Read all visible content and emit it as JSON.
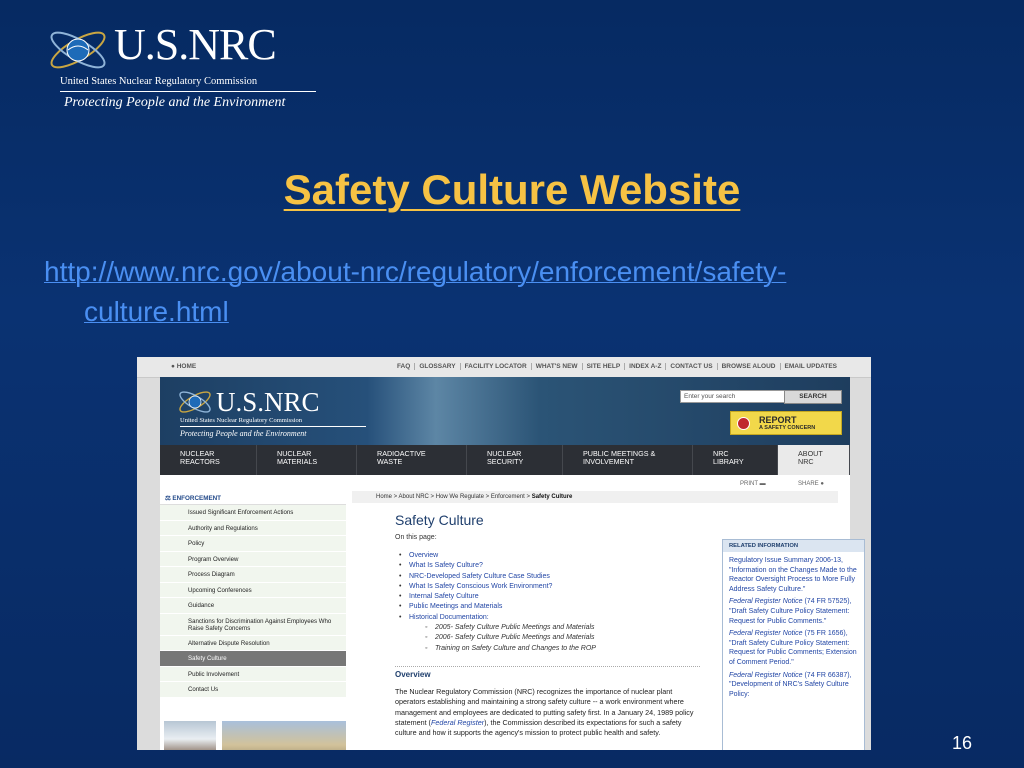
{
  "slide": {
    "logo": {
      "wordmark": "U.S.NRC",
      "agency": "United States Nuclear Regulatory Commission",
      "tagline": "Protecting People and the Environment"
    },
    "title": "Safety Culture Website",
    "url_line1": "http://www.nrc.gov/about-nrc/regulatory/enforcement/safety-",
    "url_line2": "culture.html",
    "page_number": "16"
  },
  "site": {
    "topbar": {
      "home": "HOME",
      "links": [
        "FAQ",
        "GLOSSARY",
        "FACILITY LOCATOR",
        "WHAT'S NEW",
        "SITE HELP",
        "INDEX A-Z",
        "CONTACT US",
        "BROWSE ALOUD",
        "EMAIL UPDATES"
      ]
    },
    "banner": {
      "wordmark": "U.S.NRC",
      "agency": "United States Nuclear Regulatory Commission",
      "tagline": "Protecting People and the Environment",
      "search_placeholder": "Enter your search",
      "search_button": "SEARCH",
      "report_title": "REPORT",
      "report_sub": "A SAFETY CONCERN"
    },
    "nav": [
      {
        "l1": "NUCLEAR",
        "l2": "REACTORS",
        "w": 97
      },
      {
        "l1": "NUCLEAR",
        "l2": "MATERIALS",
        "w": 100
      },
      {
        "l1": "RADIOACTIVE",
        "l2": "WASTE",
        "w": 110
      },
      {
        "l1": "NUCLEAR",
        "l2": "SECURITY",
        "w": 96
      },
      {
        "l1": "PUBLIC MEETINGS &",
        "l2": "INVOLVEMENT",
        "w": 130
      },
      {
        "l1": "NRC",
        "l2": "LIBRARY",
        "w": 85
      },
      {
        "l1": "ABOUT",
        "l2": "NRC",
        "w": 72
      }
    ],
    "tools": {
      "print": "PRINT",
      "share": "SHARE"
    },
    "sidebar": {
      "header": "ENFORCEMENT",
      "items": [
        "Issued Significant Enforcement Actions",
        "Authority and Regulations",
        "Policy",
        "Program Overview",
        "Process Diagram",
        "Upcoming Conferences",
        "Guidance",
        "Sanctions for Discrimination Against Employees Who Raise Safety Concerns",
        "Alternative Dispute Resolution",
        "Safety Culture",
        "Public Involvement",
        "Contact Us"
      ],
      "active_index": 9
    },
    "main": {
      "breadcrumb": [
        "Home",
        "About NRC",
        "How We Regulate",
        "Enforcement"
      ],
      "breadcrumb_current": "Safety Culture",
      "heading": "Safety Culture",
      "on_this_page": "On this page:",
      "toc": [
        "Overview",
        "What Is Safety Culture?",
        "NRC-Developed Safety Culture Case Studies",
        "What Is Safety Conscious Work Environment?",
        "Internal Safety Culture",
        "Public Meetings and Materials",
        "Historical Documentation:"
      ],
      "toc_sub": [
        "2005- Safety Culture Public Meetings and Materials",
        "2006- Safety Culture Public Meetings and Materials",
        "Training on Safety Culture and Changes to the ROP"
      ],
      "overview_heading": "Overview",
      "overview_a": "The Nuclear Regulatory Commission (NRC) recognizes the importance of nuclear plant operators establishing and maintaining a strong safety culture -- a work environment where management and employees are dedicated to putting safety first. In a January 24, 1989 policy statement (",
      "overview_link": "Federal Register",
      "overview_b": "), the Commission described its expectations for such a safety culture and how it supports the agency's mission to protect public health and safety."
    },
    "related": {
      "header": "RELATED INFORMATION",
      "entries": [
        {
          "pre": "",
          "text": "Regulatory Issue Summary 2006-13, \"Information on the Changes Made to the Reactor Oversight Process to More Fully Address Safety Culture.\""
        },
        {
          "pre": "Federal Register Notice",
          "text": " (74 FR 57525), \"Draft Safety Culture Policy Statement: Request for Public Comments.\""
        },
        {
          "pre": "Federal Register Notice",
          "text": " (75 FR 1656), \"Draft Safety Culture Policy Statement: Request for Public Comments; Extension of Comment Period.\""
        },
        {
          "pre": "Federal Register Notice",
          "text": " (74 FR 66387), \"Development of NRC's Safety Culture Policy:"
        }
      ]
    }
  }
}
